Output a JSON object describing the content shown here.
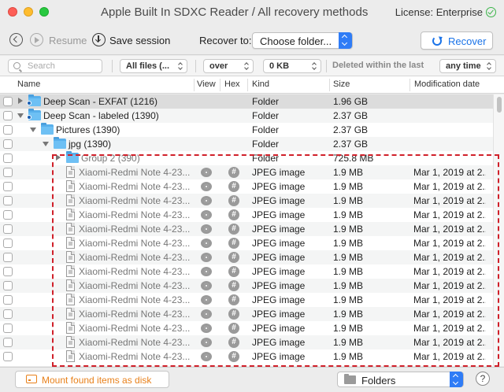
{
  "window": {
    "title": "Apple Built In SDXC Reader / All recovery methods",
    "license": "License: Enterprise"
  },
  "toolbar": {
    "resume_label": "Resume",
    "save_session_label": "Save session",
    "recover_to_label": "Recover to:",
    "recover_to_value": "Choose folder...",
    "recover_label": "Recover"
  },
  "filters": {
    "search_placeholder": "Search",
    "file_type": "All files (...",
    "size_op": "over",
    "size_value": "0 KB",
    "deleted_label": "Deleted within the last",
    "deleted_value": "any time"
  },
  "columns": {
    "name": "Name",
    "view": "View",
    "hex": "Hex",
    "kind": "Kind",
    "size": "Size",
    "modified": "Modification date"
  },
  "rows": [
    {
      "type": "folder",
      "level": 0,
      "expanded": false,
      "name": "Deep Scan - EXFAT (1216)",
      "kind": "Folder",
      "size": "1.96 GB",
      "date": "",
      "selected": true,
      "badge": true
    },
    {
      "type": "folder",
      "level": 0,
      "expanded": true,
      "name": "Deep Scan - labeled (1390)",
      "kind": "Folder",
      "size": "2.37 GB",
      "date": "",
      "badge": true
    },
    {
      "type": "folder",
      "level": 1,
      "expanded": true,
      "name": "Pictures (1390)",
      "kind": "Folder",
      "size": "2.37 GB",
      "date": ""
    },
    {
      "type": "folder",
      "level": 2,
      "expanded": true,
      "name": "jpg (1390)",
      "kind": "Folder",
      "size": "2.37 GB",
      "date": ""
    },
    {
      "type": "folder",
      "level": 3,
      "expanded": false,
      "name": "Group 2 (390)",
      "kind": "Folder",
      "size": "725.8 MB",
      "date": "",
      "gray": true
    },
    {
      "type": "file",
      "name": "Xiaomi-Redmi Note 4-23...",
      "kind": "JPEG image",
      "size": "1.9 MB",
      "date": "Mar 1, 2019 at 2..."
    },
    {
      "type": "file",
      "name": "Xiaomi-Redmi Note 4-23...",
      "kind": "JPEG image",
      "size": "1.9 MB",
      "date": "Mar 1, 2019 at 2..."
    },
    {
      "type": "file",
      "name": "Xiaomi-Redmi Note 4-23...",
      "kind": "JPEG image",
      "size": "1.9 MB",
      "date": "Mar 1, 2019 at 2..."
    },
    {
      "type": "file",
      "name": "Xiaomi-Redmi Note 4-23...",
      "kind": "JPEG image",
      "size": "1.9 MB",
      "date": "Mar 1, 2019 at 2..."
    },
    {
      "type": "file",
      "name": "Xiaomi-Redmi Note 4-23...",
      "kind": "JPEG image",
      "size": "1.9 MB",
      "date": "Mar 1, 2019 at 2..."
    },
    {
      "type": "file",
      "name": "Xiaomi-Redmi Note 4-23...",
      "kind": "JPEG image",
      "size": "1.9 MB",
      "date": "Mar 1, 2019 at 2..."
    },
    {
      "type": "file",
      "name": "Xiaomi-Redmi Note 4-23...",
      "kind": "JPEG image",
      "size": "1.9 MB",
      "date": "Mar 1, 2019 at 2..."
    },
    {
      "type": "file",
      "name": "Xiaomi-Redmi Note 4-23...",
      "kind": "JPEG image",
      "size": "1.9 MB",
      "date": "Mar 1, 2019 at 2..."
    },
    {
      "type": "file",
      "name": "Xiaomi-Redmi Note 4-23...",
      "kind": "JPEG image",
      "size": "1.9 MB",
      "date": "Mar 1, 2019 at 2..."
    },
    {
      "type": "file",
      "name": "Xiaomi-Redmi Note 4-23...",
      "kind": "JPEG image",
      "size": "1.9 MB",
      "date": "Mar 1, 2019 at 2..."
    },
    {
      "type": "file",
      "name": "Xiaomi-Redmi Note 4-23...",
      "kind": "JPEG image",
      "size": "1.9 MB",
      "date": "Mar 1, 2019 at 2..."
    },
    {
      "type": "file",
      "name": "Xiaomi-Redmi Note 4-23...",
      "kind": "JPEG image",
      "size": "1.9 MB",
      "date": "Mar 1, 2019 at 2..."
    },
    {
      "type": "file",
      "name": "Xiaomi-Redmi Note 4-23...",
      "kind": "JPEG image",
      "size": "1.9 MB",
      "date": "Mar 1, 2019 at 2..."
    },
    {
      "type": "file",
      "name": "Xiaomi-Redmi Note 4-23...",
      "kind": "JPEG image",
      "size": "1.9 MB",
      "date": "Mar 1, 2019 at 2..."
    }
  ],
  "bottom": {
    "mount_label": "Mount found items as disk",
    "view_mode": "Folders",
    "help": "?"
  },
  "colors": {
    "accent": "#2f7cf6",
    "recover_text": "#1a73e8",
    "mount_text": "#e8801a",
    "highlight_box": "#d0202a"
  },
  "icons": {
    "hex_glyph": "#"
  }
}
